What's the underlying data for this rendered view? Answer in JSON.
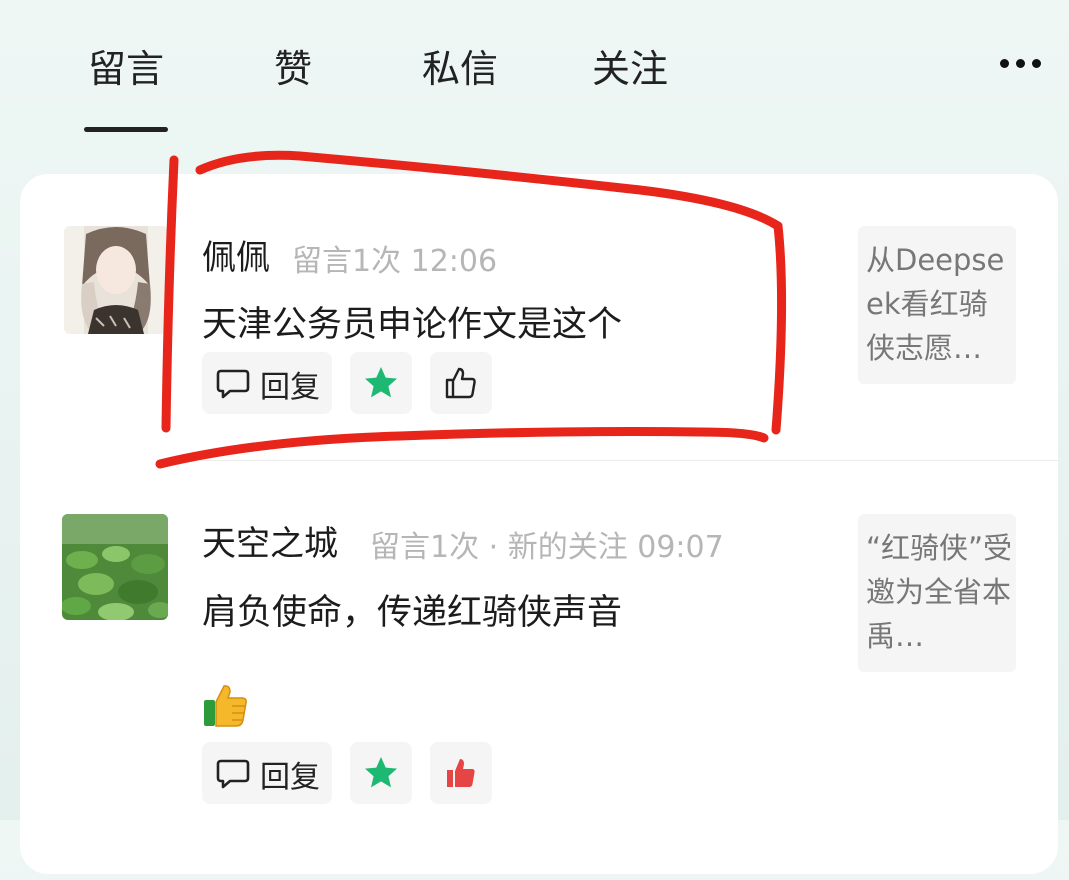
{
  "tabs": [
    {
      "label": "留言",
      "active": true
    },
    {
      "label": "赞",
      "active": false
    },
    {
      "label": "私信",
      "active": false
    },
    {
      "label": "关注",
      "active": false
    }
  ],
  "more_icon": "more-dots-icon",
  "items": [
    {
      "name": "佩佩",
      "meta": "留言1次  12:06",
      "message": "天津公务员申论作文是这个",
      "reply_label": "回复",
      "preview": "从Deepseek看红骑侠志愿…",
      "liked": false,
      "highlighted": true
    },
    {
      "name": "天空之城",
      "meta": "留言1次 · 新的关注 09:07",
      "message": "肩负使命，传递红骑侠声音",
      "emoji": "thumbs-up-emoji",
      "reply_label": "回复",
      "preview": "“红骑侠”受邀为全省本禹…",
      "liked": true,
      "highlighted": false
    }
  ],
  "colors": {
    "star": "#1db871",
    "like_active": "#e64545",
    "annotation": "#e8251a"
  }
}
